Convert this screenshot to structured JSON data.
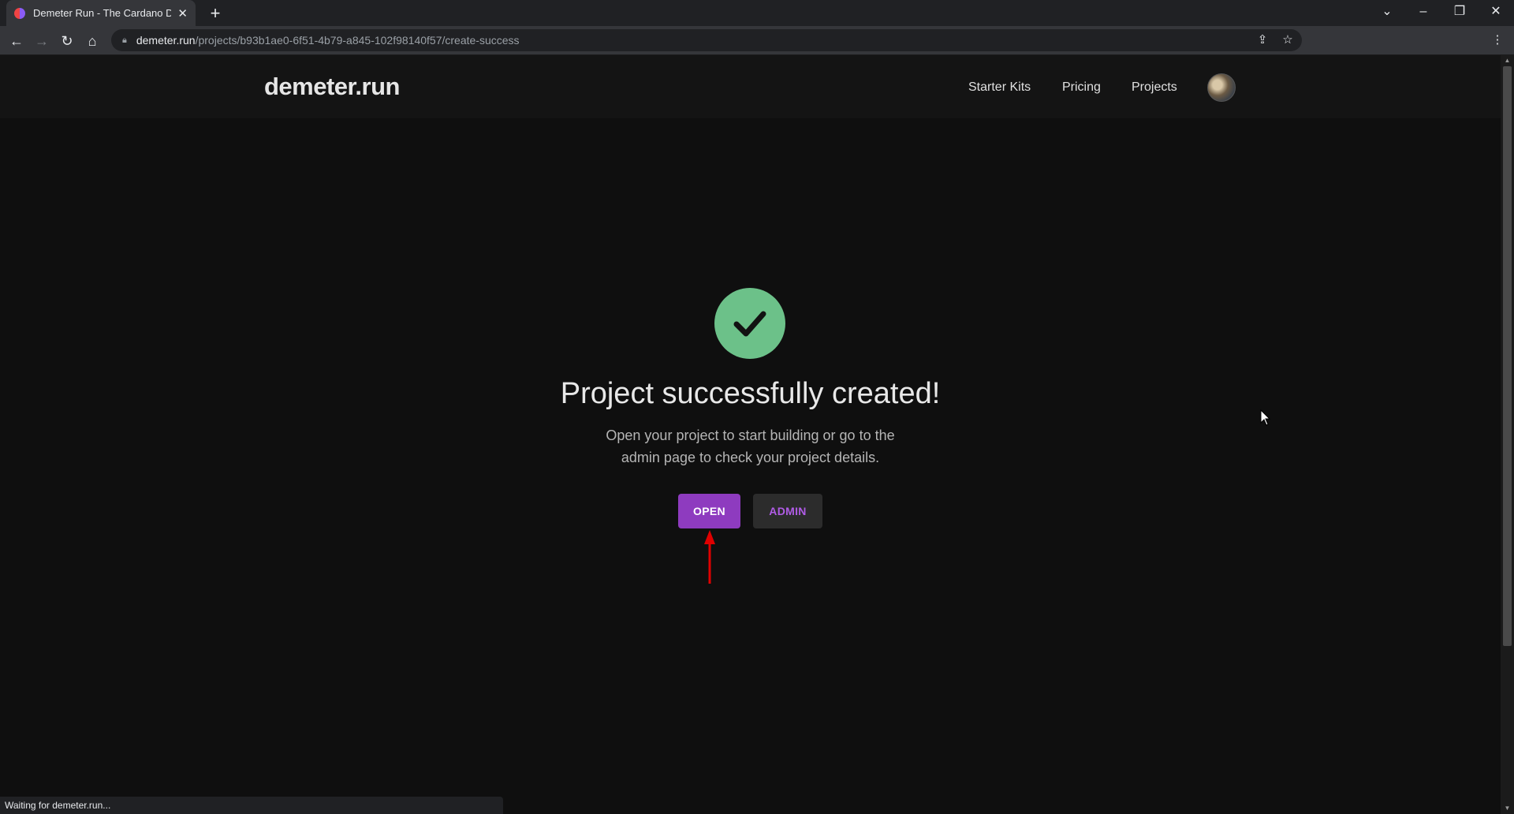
{
  "browser": {
    "tab_title": "Demeter Run - The Cardano Dev",
    "tab_close": "✕",
    "new_tab": "+",
    "url_host": "demeter.run",
    "url_path": "/projects/b93b1ae0-6f51-4b79-a845-102f98140f57/create-success",
    "status_text": "Waiting for demeter.run..."
  },
  "site": {
    "logo": "demeter.run",
    "nav": {
      "starter_kits": "Starter Kits",
      "pricing": "Pricing",
      "projects": "Projects"
    }
  },
  "main": {
    "headline": "Project successfully created!",
    "subtext_line1": "Open your project to start building or go to the",
    "subtext_line2": "admin page to check your project details.",
    "open_label": "OPEN",
    "admin_label": "ADMIN"
  },
  "colors": {
    "success_green": "#6cc189",
    "open_button": "#8e3bbf",
    "admin_text": "#b05ce6",
    "annotation_arrow": "#e00000"
  },
  "icons": {
    "success": "checkmark-icon",
    "annotation": "red-arrow-icon"
  }
}
